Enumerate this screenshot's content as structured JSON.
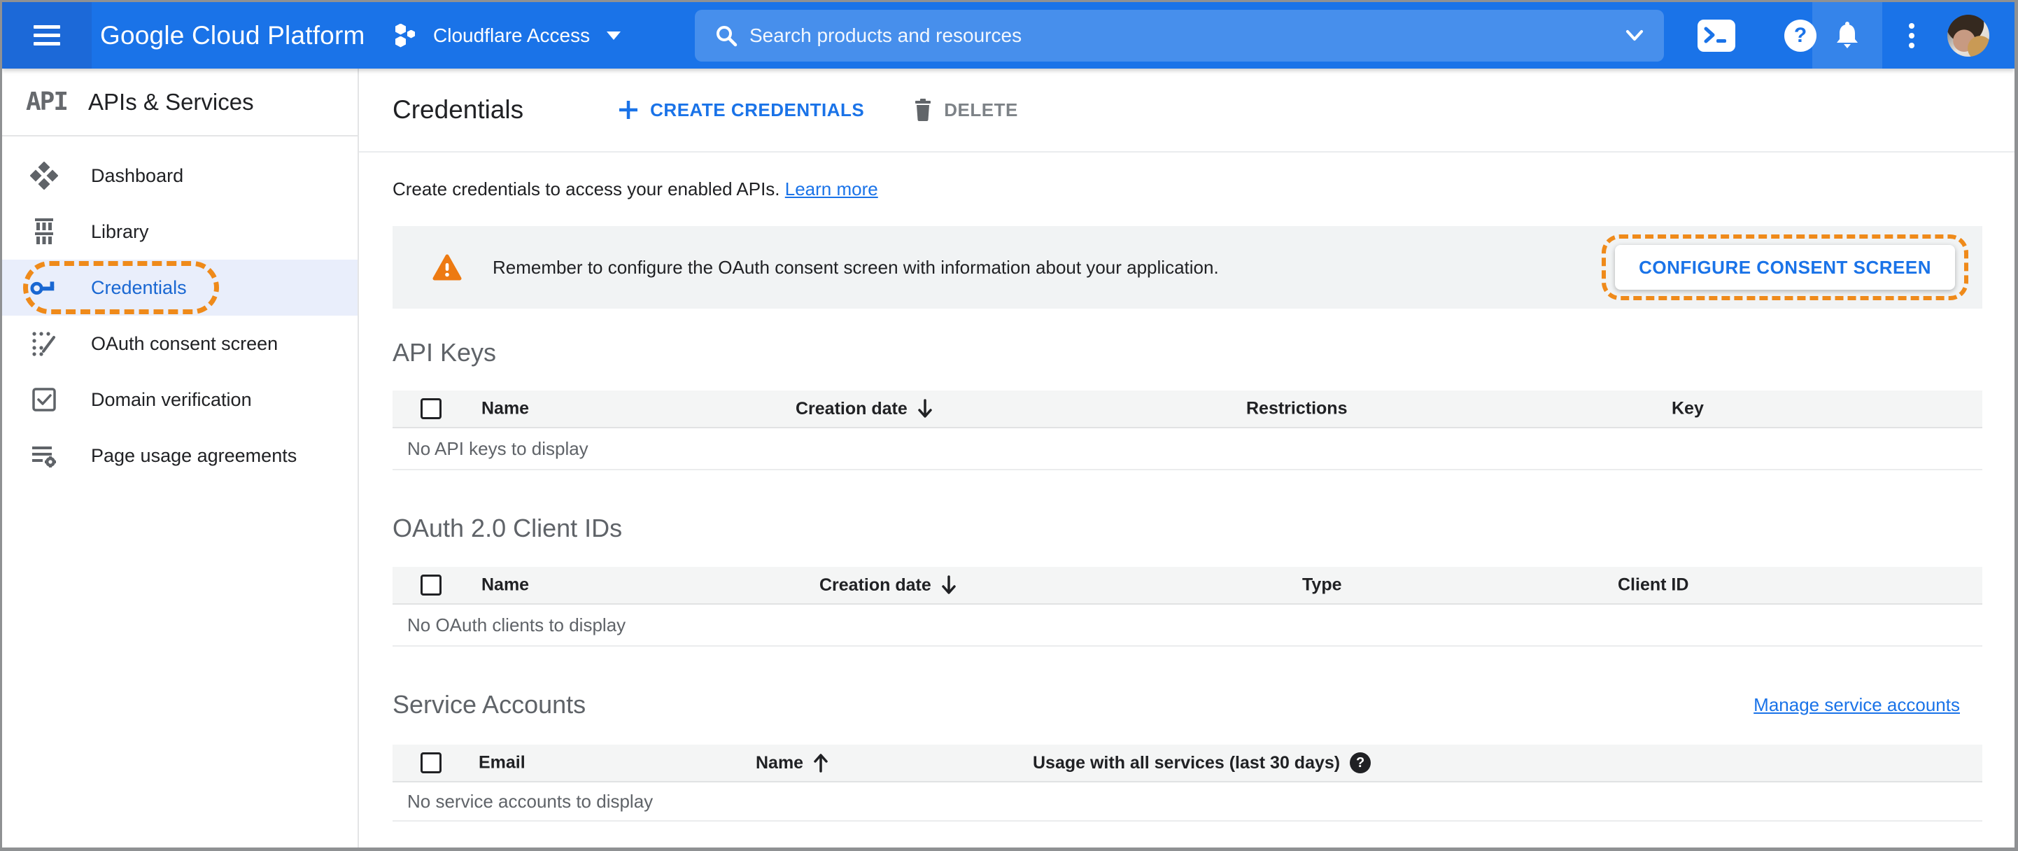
{
  "topbar": {
    "logo": "Google Cloud Platform",
    "project_name": "Cloudflare Access",
    "search_placeholder": "Search products and resources"
  },
  "sidebar": {
    "logo_text": "API",
    "title": "APIs & Services",
    "items": [
      {
        "label": "Dashboard",
        "selected": false
      },
      {
        "label": "Library",
        "selected": false
      },
      {
        "label": "Credentials",
        "selected": true
      },
      {
        "label": "OAuth consent screen",
        "selected": false
      },
      {
        "label": "Domain verification",
        "selected": false
      },
      {
        "label": "Page usage agreements",
        "selected": false
      }
    ]
  },
  "page": {
    "title": "Credentials",
    "create_button": "CREATE CREDENTIALS",
    "delete_button": "DELETE",
    "intro_text": "Create credentials to access your enabled APIs.",
    "intro_link": "Learn more"
  },
  "banner": {
    "message": "Remember to configure the OAuth consent screen with information about your application.",
    "action": "CONFIGURE CONSENT SCREEN"
  },
  "api_keys": {
    "title": "API Keys",
    "columns": [
      "Name",
      "Creation date",
      "Restrictions",
      "Key"
    ],
    "sort_column": "Creation date",
    "sort_direction": "desc",
    "empty": "No API keys to display"
  },
  "oauth_clients": {
    "title": "OAuth 2.0 Client IDs",
    "columns": [
      "Name",
      "Creation date",
      "Type",
      "Client ID"
    ],
    "sort_column": "Creation date",
    "sort_direction": "desc",
    "empty": "No OAuth clients to display"
  },
  "service_accounts": {
    "title": "Service Accounts",
    "manage_link": "Manage service accounts",
    "columns": [
      "Email",
      "Name",
      "Usage with all services (last 30 days)"
    ],
    "sort_column": "Name",
    "sort_direction": "asc",
    "empty": "No service accounts to display"
  },
  "colors": {
    "topbar_blue": "#1a73e8",
    "topbar_dark_blue": "#1c69d8",
    "selected_item_blue": "#1967d2",
    "selected_item_bg": "#e9eefb",
    "annotation_orange": "#ef8a1a",
    "warning_orange": "#ed7a12",
    "banner_bg": "#f1f3f4"
  }
}
